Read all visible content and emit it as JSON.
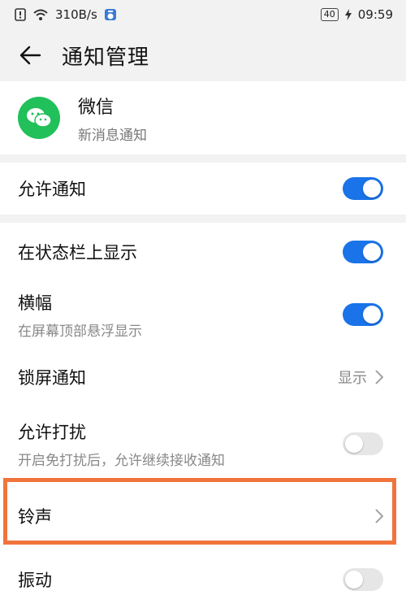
{
  "status_bar": {
    "speed": "310B/s",
    "battery": "40",
    "time": "09:59"
  },
  "header": {
    "title": "通知管理"
  },
  "app": {
    "name": "微信",
    "subtitle": "新消息通知"
  },
  "settings": {
    "allow_notifications": {
      "label": "允许通知",
      "enabled": true
    },
    "status_bar_display": {
      "label": "在状态栏上显示",
      "enabled": true
    },
    "banner": {
      "label": "横幅",
      "description": "在屏幕顶部悬浮显示",
      "enabled": true
    },
    "lockscreen": {
      "label": "锁屏通知",
      "value": "显示"
    },
    "dnd": {
      "label": "允许打扰",
      "description": "开启免打扰后，允许继续接收通知",
      "enabled": false
    },
    "ringtone": {
      "label": "铃声"
    },
    "vibration": {
      "label": "振动",
      "enabled": false
    }
  },
  "colors": {
    "toggle_on": "#1a73e8",
    "toggle_off": "#e6e6e6",
    "wechat_green": "#21c05a",
    "highlight": "#f0743c"
  }
}
